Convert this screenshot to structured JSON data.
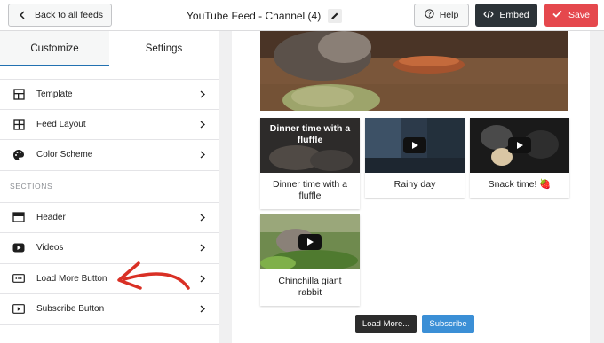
{
  "topbar": {
    "back_label": "Back to all feeds",
    "title": "YouTube Feed - Channel (4)",
    "help_label": "Help",
    "embed_label": "Embed",
    "save_label": "Save"
  },
  "sidebar": {
    "tabs": [
      {
        "label": "Customize",
        "active": true
      },
      {
        "label": "Settings",
        "active": false
      }
    ],
    "items": [
      {
        "label": "Template",
        "icon": "template-icon"
      },
      {
        "label": "Feed Layout",
        "icon": "grid-layout-icon"
      },
      {
        "label": "Color Scheme",
        "icon": "palette-icon"
      }
    ],
    "section_label": "SECTIONS",
    "section_items": [
      {
        "label": "Header",
        "icon": "header-icon"
      },
      {
        "label": "Videos",
        "icon": "youtube-play-icon"
      },
      {
        "label": "Load More Button",
        "icon": "load-more-icon"
      },
      {
        "label": "Subscribe Button",
        "icon": "subscribe-icon"
      }
    ]
  },
  "preview": {
    "videos": [
      {
        "caption": "Dinner time with a fluffle",
        "overlay_title": "Dinner time with a fluffle"
      },
      {
        "caption": "Rainy day",
        "overlay_title": ""
      },
      {
        "caption": "Snack time! 🍓",
        "overlay_title": ""
      },
      {
        "caption": "Chinchilla giant rabbit",
        "overlay_title": ""
      }
    ],
    "load_more_label": "Load More...",
    "subscribe_label": "Subscribe"
  },
  "colors": {
    "accent": "#2271b1",
    "save": "#e5484d",
    "embed": "#2c3338",
    "subscribe": "#3b8fd6",
    "annotation_arrow": "#d93025"
  }
}
